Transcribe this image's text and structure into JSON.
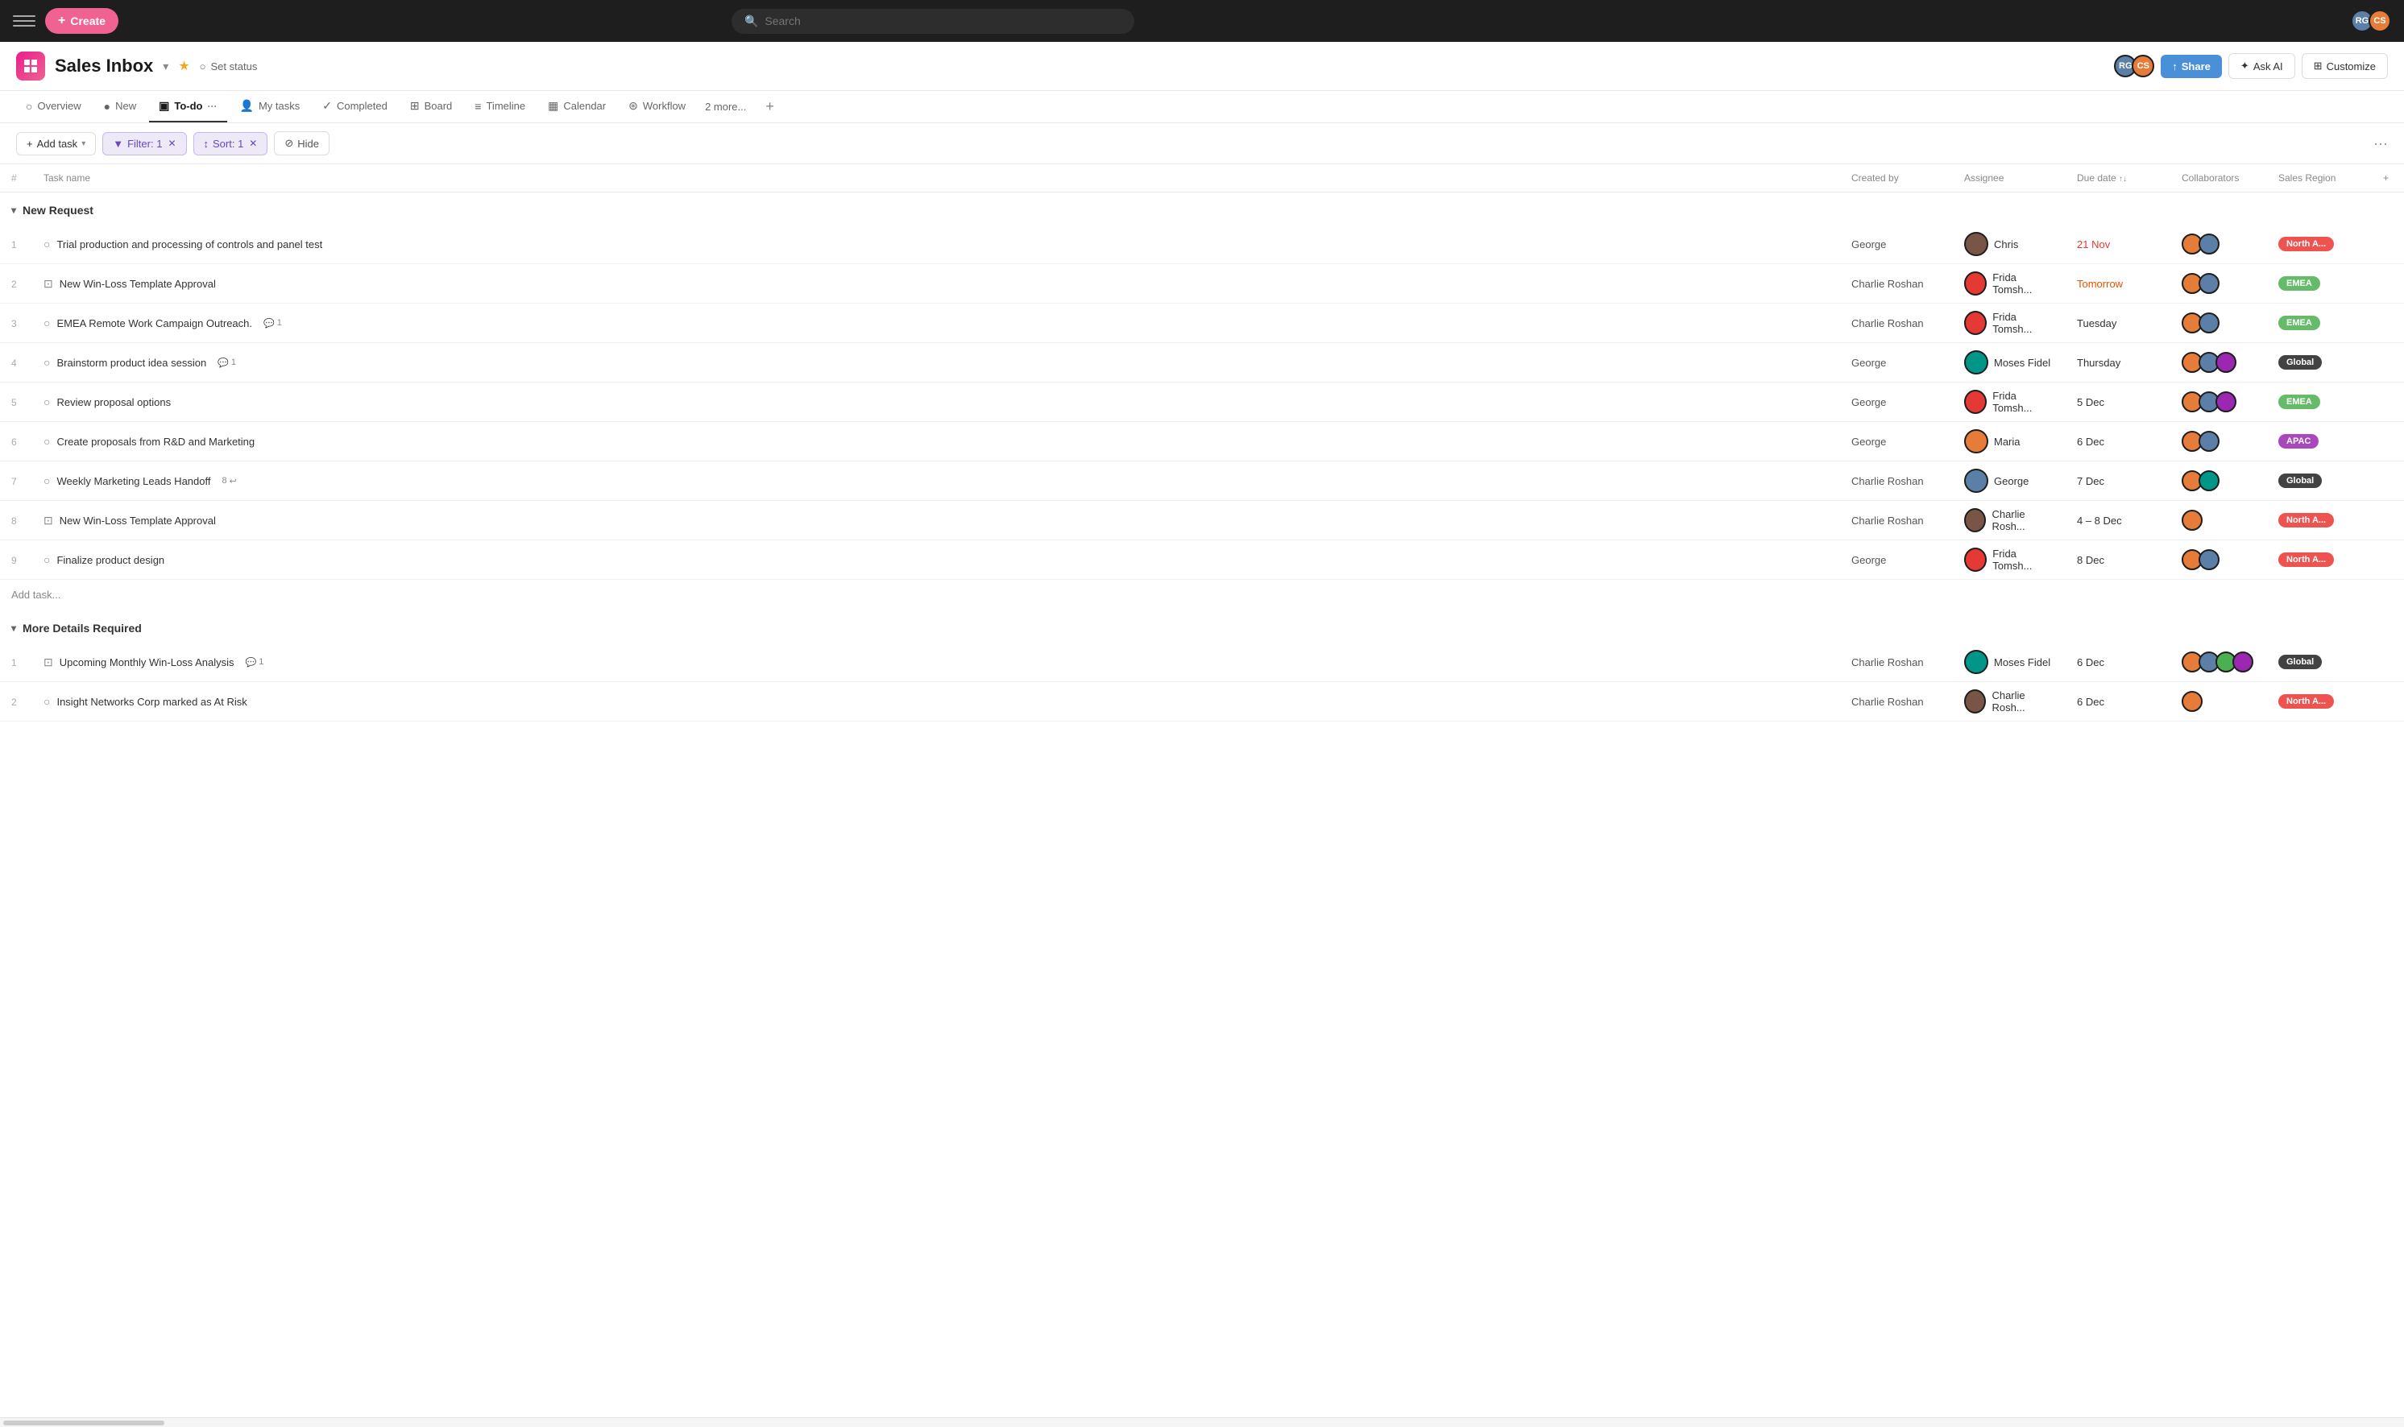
{
  "topbar": {
    "create_label": "Create",
    "search_placeholder": "Search"
  },
  "project": {
    "title": "Sales Inbox",
    "status_label": "Set status",
    "share_label": "Share",
    "ask_ai_label": "Ask AI",
    "customize_label": "Customize"
  },
  "tabs": [
    {
      "id": "overview",
      "label": "Overview",
      "icon": "○",
      "active": false
    },
    {
      "id": "new",
      "label": "New",
      "icon": "●",
      "active": false
    },
    {
      "id": "todo",
      "label": "To-do",
      "icon": "▣",
      "active": true
    },
    {
      "id": "mytasks",
      "label": "My tasks",
      "icon": "👤",
      "active": false
    },
    {
      "id": "completed",
      "label": "Completed",
      "icon": "✓",
      "active": false
    },
    {
      "id": "board",
      "label": "Board",
      "icon": "⊞",
      "active": false
    },
    {
      "id": "timeline",
      "label": "Timeline",
      "icon": "≡",
      "active": false
    },
    {
      "id": "calendar",
      "label": "Calendar",
      "icon": "▦",
      "active": false
    },
    {
      "id": "workflow",
      "label": "Workflow",
      "icon": "⊛",
      "active": false
    }
  ],
  "more_tabs_label": "2 more...",
  "toolbar": {
    "add_task_label": "Add task",
    "filter_label": "Filter: 1",
    "sort_label": "Sort: 1",
    "hide_label": "Hide"
  },
  "columns": {
    "hash": "#",
    "task_name": "Task name",
    "created_by": "Created by",
    "assignee": "Assignee",
    "due_date": "Due date",
    "collaborators": "Collaborators",
    "sales_region": "Sales Region"
  },
  "sections": [
    {
      "id": "new-request",
      "title": "New Request",
      "expanded": true,
      "rows": [
        {
          "num": "1",
          "task": "Trial production and processing of controls and panel test",
          "task_type": "circle",
          "created_by": "George",
          "assignee": "Chris",
          "assignee_color": "brown",
          "due": "21 Nov",
          "due_type": "overdue",
          "region": "North A...",
          "region_type": "north",
          "collab_colors": [
            "orange",
            "blue"
          ]
        },
        {
          "num": "2",
          "task": "New Win-Loss Template Approval",
          "task_type": "template",
          "created_by": "Charlie Roshan",
          "assignee": "Frida Tomsh...",
          "assignee_color": "red",
          "due": "Tomorrow",
          "due_type": "tomorrow",
          "region": "EMEA",
          "region_type": "emea",
          "collab_colors": [
            "orange",
            "blue"
          ]
        },
        {
          "num": "3",
          "task": "EMEA Remote Work Campaign Outreach.",
          "task_type": "circle",
          "badge_comment": "1",
          "created_by": "Charlie Roshan",
          "assignee": "Frida Tomsh...",
          "assignee_color": "red",
          "due": "Tuesday",
          "due_type": "normal",
          "region": "EMEA",
          "region_type": "emea",
          "collab_colors": [
            "orange",
            "blue"
          ]
        },
        {
          "num": "4",
          "task": "Brainstorm product idea session",
          "task_type": "circle",
          "badge_comment": "1",
          "created_by": "George",
          "assignee": "Moses Fidel",
          "assignee_color": "teal",
          "due": "Thursday",
          "due_type": "normal",
          "region": "Global",
          "region_type": "global",
          "collab_colors": [
            "orange",
            "blue",
            "purple"
          ]
        },
        {
          "num": "5",
          "task": "Review proposal options",
          "task_type": "circle",
          "created_by": "George",
          "assignee": "Frida Tomsh...",
          "assignee_color": "red",
          "due": "5 Dec",
          "due_type": "normal",
          "region": "EMEA",
          "region_type": "emea",
          "collab_colors": [
            "orange",
            "blue",
            "purple"
          ]
        },
        {
          "num": "6",
          "task": "Create proposals from R&D and Marketing",
          "task_type": "circle",
          "created_by": "George",
          "assignee": "Maria",
          "assignee_color": "orange",
          "due": "6 Dec",
          "due_type": "normal",
          "region": "APAC",
          "region_type": "apac",
          "collab_colors": [
            "orange",
            "blue"
          ]
        },
        {
          "num": "7",
          "task": "Weekly Marketing Leads Handoff",
          "task_type": "circle",
          "badge_subtask": "8",
          "created_by": "Charlie Roshan",
          "assignee": "George",
          "assignee_color": "blue",
          "due": "7 Dec",
          "due_type": "normal",
          "region": "Global",
          "region_type": "global",
          "collab_colors": [
            "orange",
            "teal"
          ]
        },
        {
          "num": "8",
          "task": "New Win-Loss Template Approval",
          "task_type": "template",
          "created_by": "Charlie Roshan",
          "assignee": "Charlie Rosh...",
          "assignee_color": "brown",
          "due": "4 – 8 Dec",
          "due_type": "normal",
          "region": "North A...",
          "region_type": "north",
          "collab_colors": [
            "orange"
          ]
        },
        {
          "num": "9",
          "task": "Finalize product design",
          "task_type": "circle",
          "created_by": "George",
          "assignee": "Frida Tomsh...",
          "assignee_color": "red",
          "due": "8 Dec",
          "due_type": "normal",
          "region": "North A...",
          "region_type": "north",
          "collab_colors": [
            "orange",
            "blue"
          ]
        }
      ],
      "add_task_label": "Add task..."
    },
    {
      "id": "more-details",
      "title": "More Details Required",
      "expanded": true,
      "rows": [
        {
          "num": "1",
          "task": "Upcoming Monthly Win-Loss Analysis",
          "task_type": "template",
          "badge_comment": "1",
          "created_by": "Charlie Roshan",
          "assignee": "Moses Fidel",
          "assignee_color": "teal",
          "due": "6 Dec",
          "due_type": "normal",
          "region": "Global",
          "region_type": "global",
          "collab_colors": [
            "orange",
            "blue",
            "green",
            "purple"
          ]
        },
        {
          "num": "2",
          "task": "Insight Networks Corp marked as At Risk",
          "task_type": "circle",
          "created_by": "Charlie Roshan",
          "assignee": "Charlie Rosh...",
          "assignee_color": "brown",
          "due": "6 Dec",
          "due_type": "normal",
          "region": "North A...",
          "region_type": "north",
          "collab_colors": [
            "orange"
          ]
        }
      ]
    }
  ]
}
